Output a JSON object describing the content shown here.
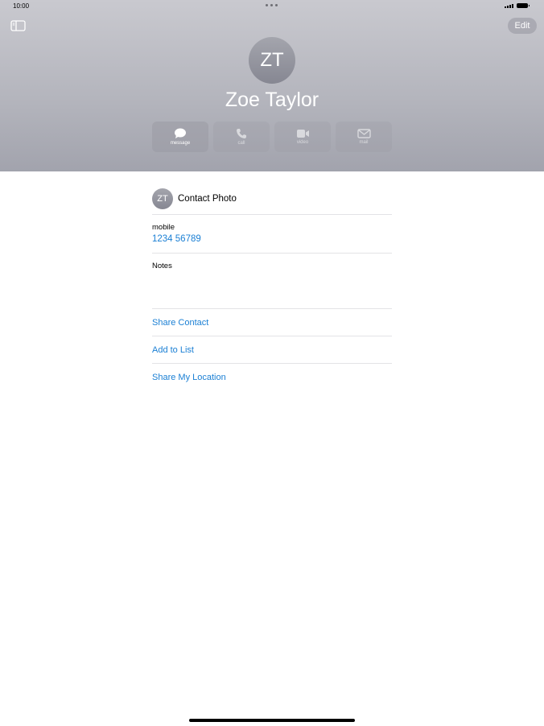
{
  "status": {
    "time": "10:00"
  },
  "header": {
    "edit_label": "Edit",
    "initials": "ZT",
    "name": "Zoe Taylor"
  },
  "actions": [
    {
      "icon": "message-icon",
      "label": "message"
    },
    {
      "icon": "phone-icon",
      "label": "call"
    },
    {
      "icon": "video-icon",
      "label": "video"
    },
    {
      "icon": "mail-icon",
      "label": "mail"
    }
  ],
  "details": {
    "photo_initials": "ZT",
    "photo_label": "Contact Photo",
    "mobile_label": "mobile",
    "mobile_number": "1234 56789",
    "notes_label": "Notes"
  },
  "links": [
    "Share Contact",
    "Add to List",
    "Share My Location"
  ],
  "colors": {
    "link": "#1a7fd4",
    "header_top": "#c9c9cf",
    "header_bottom": "#a2a3ad"
  }
}
